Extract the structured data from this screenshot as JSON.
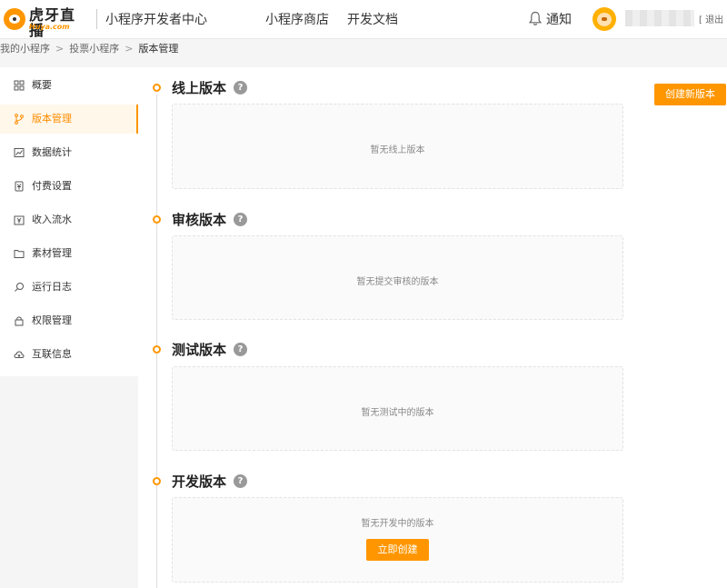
{
  "header": {
    "logo_cn": "虎牙直播",
    "logo_en": "Huya.com",
    "site_title": "小程序开发者中心",
    "nav": {
      "store": "小程序商店",
      "docs": "开发文档"
    },
    "notify": "通知",
    "logout": "[ 退出 ]"
  },
  "breadcrumb": {
    "items": [
      "我的小程序",
      "投票小程序",
      "版本管理"
    ],
    "separator": ">"
  },
  "sidebar": {
    "items": [
      {
        "label": "概要",
        "icon": "grid-icon"
      },
      {
        "label": "版本管理",
        "icon": "branch-icon",
        "active": true
      },
      {
        "label": "数据统计",
        "icon": "chart-icon"
      },
      {
        "label": "付费设置",
        "icon": "wallet-icon"
      },
      {
        "label": "收入流水",
        "icon": "income-icon"
      },
      {
        "label": "素材管理",
        "icon": "folder-icon"
      },
      {
        "label": "运行日志",
        "icon": "search-icon"
      },
      {
        "label": "权限管理",
        "icon": "lock-icon"
      },
      {
        "label": "互联信息",
        "icon": "cloud-icon"
      }
    ]
  },
  "actions": {
    "create_version": "创建新版本"
  },
  "sections": {
    "online": {
      "title": "线上版本",
      "empty": "暂无线上版本"
    },
    "review": {
      "title": "审核版本",
      "empty": "暂无提交审核的版本"
    },
    "test": {
      "title": "测试版本",
      "empty": "暂无测试中的版本"
    },
    "dev": {
      "title": "开发版本",
      "empty": "暂无开发中的版本",
      "button": "立即创建"
    }
  },
  "colors": {
    "accent": "#ff9600",
    "active_bg": "#fff7ea",
    "help": "#999999"
  }
}
